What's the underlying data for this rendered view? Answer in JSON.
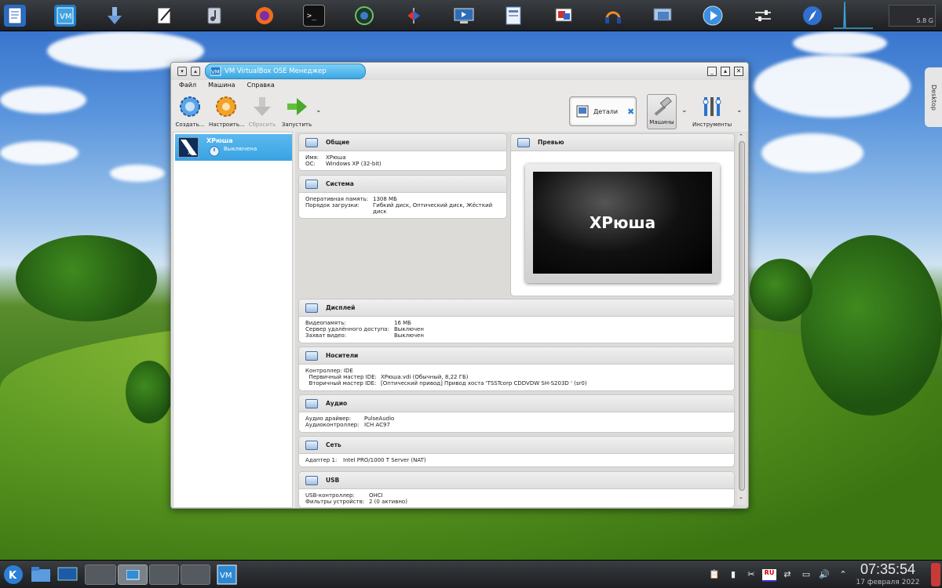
{
  "top_panel": {
    "icons": [
      "text-editor-icon",
      "virtualbox-icon",
      "download-icon",
      "notes-icon",
      "music-icon",
      "firefox-icon",
      "terminal-icon",
      "globe-icon",
      "network-icon",
      "monitor-icon",
      "document-icon",
      "presentation-icon",
      "headphones-icon",
      "screen-icon",
      "media-player-icon",
      "settings-icon",
      "browser-icon"
    ],
    "memory_label": "5.8 G"
  },
  "desktop_tab": "Desktop",
  "window": {
    "title": "VM VirtualBox OSE Менеджер",
    "menu": [
      "Файл",
      "Машина",
      "Справка"
    ],
    "toolbar": {
      "create": "Создать...",
      "settings": "Настроить...",
      "discard": "Сбросить",
      "start": "Запустить",
      "details": "Детали",
      "machines": "Машины",
      "tools": "Инструменты"
    },
    "vm_list": [
      {
        "name": "XPюша",
        "state": "Выключена"
      }
    ],
    "sections": {
      "general": {
        "title": "Общие",
        "rows": [
          {
            "k": "Имя:",
            "v": "XPюша"
          },
          {
            "k": "ОС:",
            "v": "Windows XP (32-bit)"
          }
        ]
      },
      "system": {
        "title": "Система",
        "rows": [
          {
            "k": "Оперативная память:",
            "v": "1308 МБ"
          },
          {
            "k": "Порядок загрузки:",
            "v": "Гибкий диск, Оптический диск, Жёсткий"
          },
          {
            "k": "",
            "v": "диск"
          }
        ]
      },
      "preview": {
        "title": "Превью",
        "screen_text": "XPюша"
      },
      "display": {
        "title": "Дисплей",
        "rows": [
          {
            "k": "Видеопамять:",
            "v": "16 МБ"
          },
          {
            "k": "Сервер удалённого доступа:",
            "v": "Выключен"
          },
          {
            "k": "Захват видео:",
            "v": "Выключен"
          }
        ]
      },
      "storage": {
        "title": "Носители",
        "rows": [
          {
            "k": "Контроллер: IDE",
            "v": ""
          },
          {
            "k": "  Первичный мастер IDE:",
            "v": "XPюша.vdi (Обычный, 8,22 ГБ)"
          },
          {
            "k": "  Вторичный мастер IDE:",
            "v": "[Оптический привод] Привод хоста 'TSSTcorp CDDVDW SH-S203D ' (sr0)"
          }
        ]
      },
      "audio": {
        "title": "Аудио",
        "rows": [
          {
            "k": "Аудио драйвер:",
            "v": "PulseAudio"
          },
          {
            "k": "Аудиоконтроллер:",
            "v": "ICH AC97"
          }
        ]
      },
      "network": {
        "title": "Сеть",
        "rows": [
          {
            "k": "Адаптер 1:",
            "v": "Intel PRO/1000 T Server (NAT)"
          }
        ]
      },
      "usb": {
        "title": "USB",
        "rows": [
          {
            "k": "USB-контроллер:",
            "v": "OHCI"
          },
          {
            "k": "Фильтры устройств:",
            "v": "2 (0 активно)"
          }
        ]
      }
    }
  },
  "taskbar": {
    "tray_icons": [
      "clipboard-icon",
      "signal-icon",
      "scissors-icon",
      "keyboard-layout-icon",
      "network-icon",
      "display-icon",
      "volume-icon",
      "expand-icon"
    ],
    "keyboard_layout": "RU",
    "time": "07:35:54",
    "date": "17 февраля 2022"
  }
}
